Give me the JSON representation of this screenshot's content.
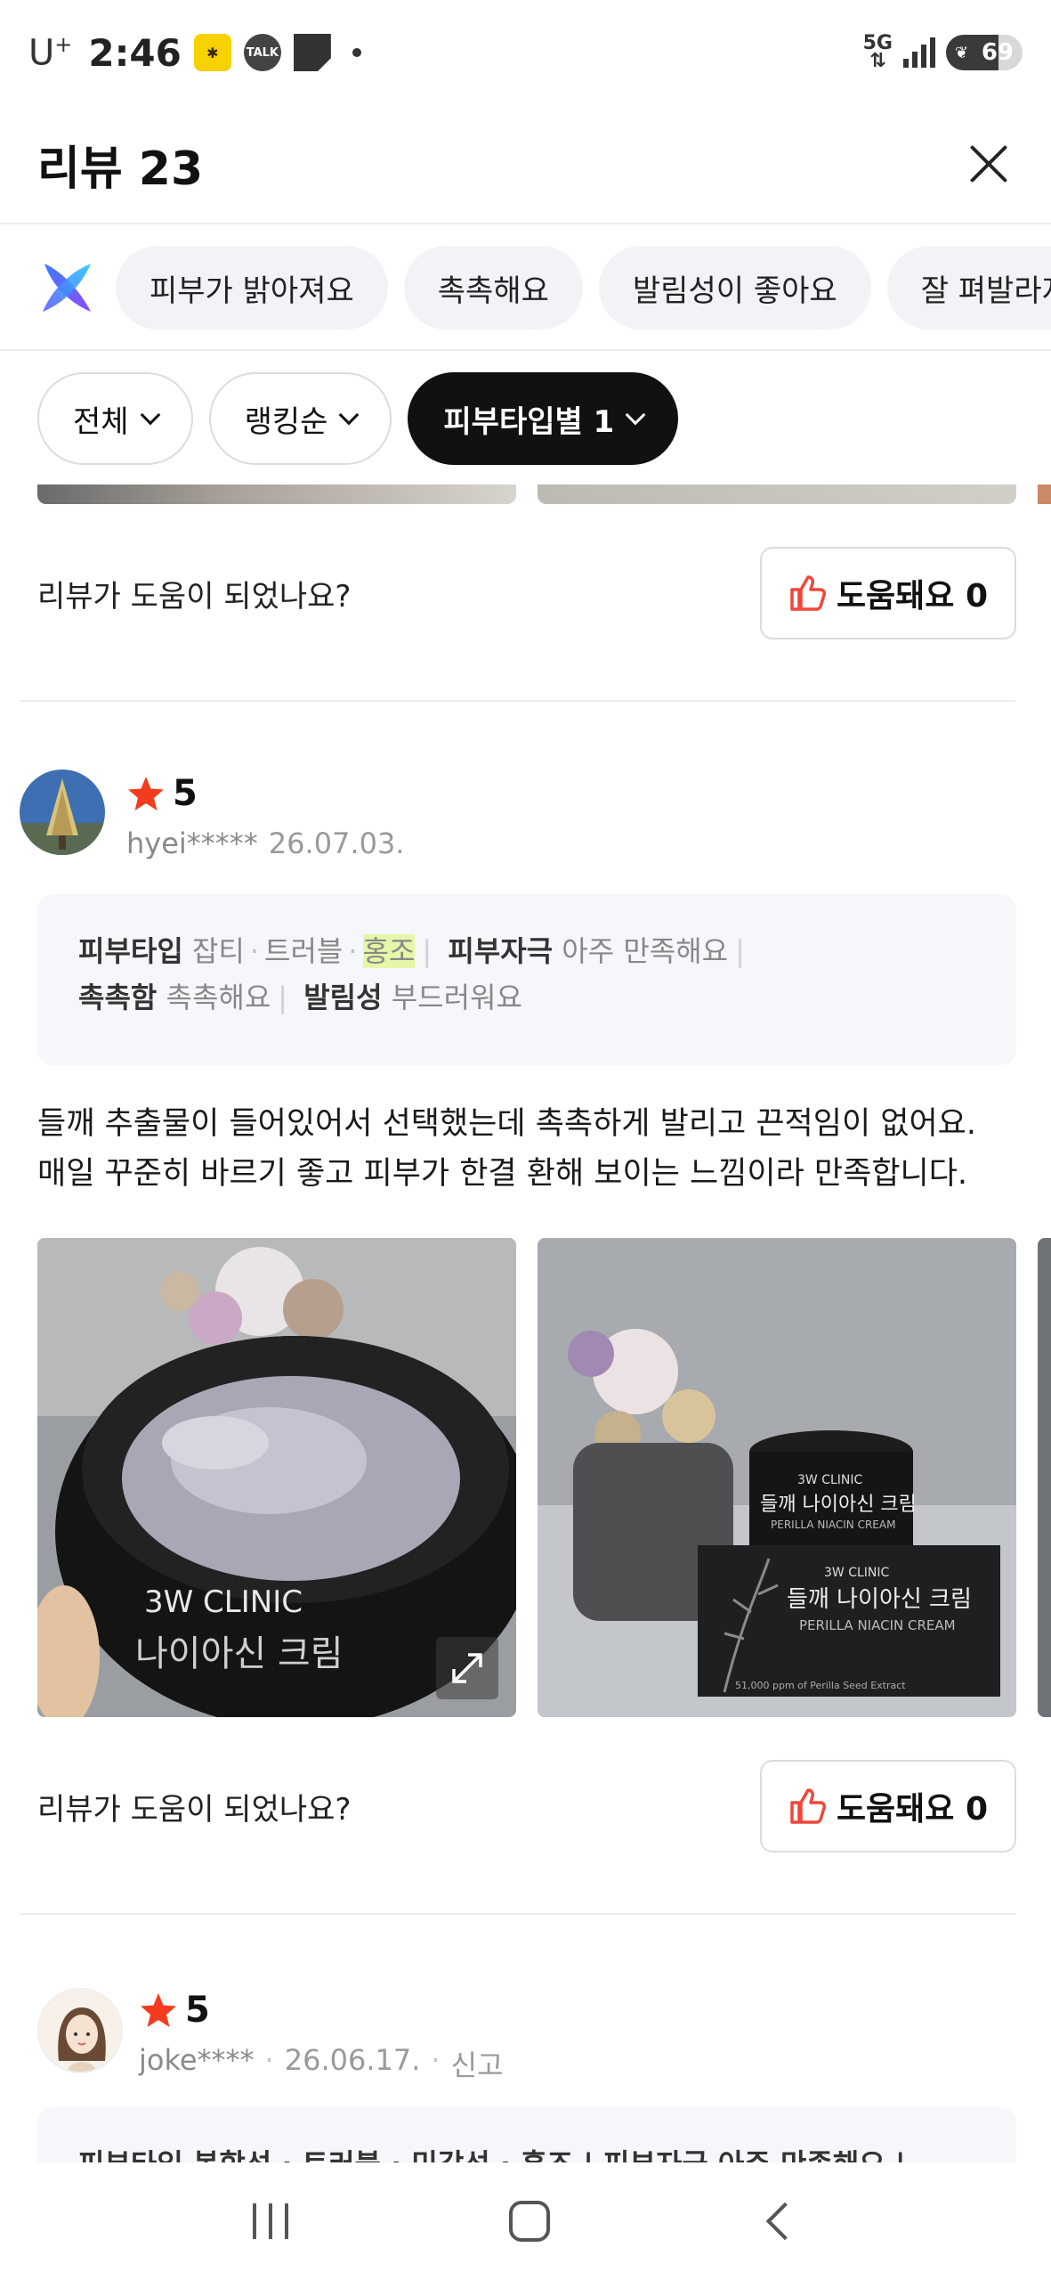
{
  "status_bar": {
    "carrier": "U",
    "carrier_sup": "+",
    "time": "2:46",
    "talk_label": "TALK",
    "network": "5G",
    "battery": "69"
  },
  "header": {
    "title": "리뷰 23"
  },
  "keywords": [
    "피부가 밝아져요",
    "촉촉해요",
    "발림성이 좋아요",
    "잘 펴발라져요"
  ],
  "filters": [
    {
      "label": "전체"
    },
    {
      "label": "랭킹순"
    },
    {
      "label": "피부타입별 1"
    }
  ],
  "helpful": {
    "question": "리뷰가 도움이 되었나요?",
    "button_label": "도움돼요 0"
  },
  "reviews": [
    {
      "rating": "5",
      "user": "hyei*****",
      "date": "26.07.03.",
      "attributes": {
        "skin_type_label": "피부타입",
        "skin_type_values": [
          "잡티",
          "트러블",
          "홍조"
        ],
        "irritation_label": "피부자극",
        "irritation_value": "아주 만족해요",
        "moisture_label": "촉촉함",
        "moisture_value": "촉촉해요",
        "spread_label": "발림성",
        "spread_value": "부드러워요"
      },
      "text_line1": "들깨 추출물이 들어있어서 선택했는데 촉촉하게 발리고 끈적임이 없어요.",
      "text_line2": "매일 꾸준히 바르기 좋고 피부가 한결 환해 보이는 느낌이라 만족합니다.",
      "photo2": {
        "brand": "3W CLINIC",
        "product_kr": "들깨 나이아신 크림",
        "product_en": "PERILLA NIACIN CREAM",
        "extract": "51,000 ppm of Perilla Seed Extract"
      },
      "photo1": {
        "brand": "3W CLINIC",
        "product_kr": "나이아신 크림"
      },
      "helpful_label": "도움돼요 0"
    },
    {
      "rating": "5",
      "user": "joke****",
      "date": "26.06.17.",
      "report": "신고",
      "attr_peek": "피부타입 복합성 · 트러블 · 민감성 · 홍조 | 피부자극 아주 만족해요 |"
    }
  ],
  "colors": {
    "star": "#f23b1f",
    "thumb": "#f0473a",
    "highlight": "#e5f7a8",
    "chip_bg": "#f1f3f6",
    "active_filter": "#111111"
  }
}
